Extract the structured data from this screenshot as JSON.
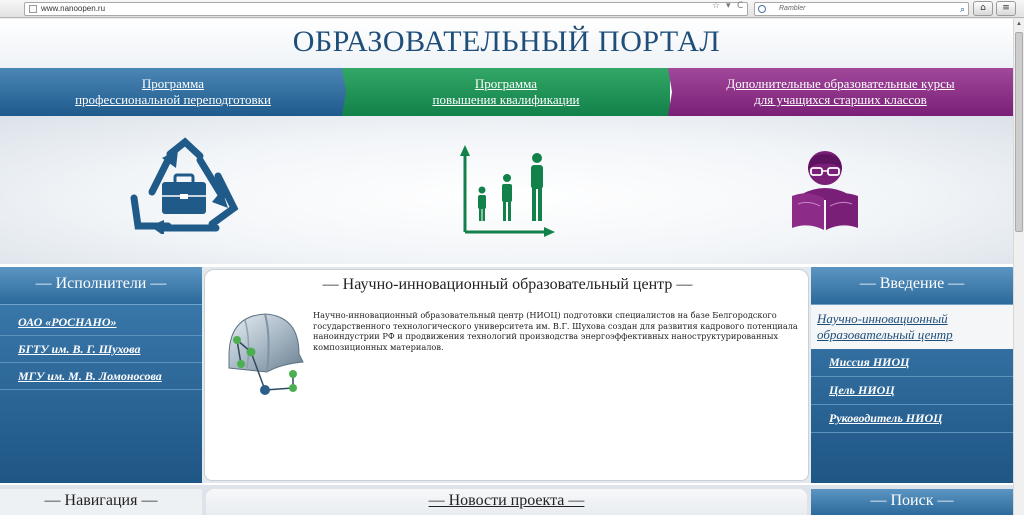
{
  "browser": {
    "url": "www.nanoopen.ru",
    "search_placeholder": "Rambler",
    "star": "☆",
    "dropdown": "▾",
    "reload": "C",
    "search_btn": "⌕",
    "home_btn": "⌂",
    "menu_btn": "≡"
  },
  "header": {
    "title": "ОБРАЗОВАТЕЛЬНЫЙ ПОРТАЛ"
  },
  "tabs": [
    {
      "line1": "Программа",
      "line2": "профессиональной переподготовки",
      "color": "#1e5a8c"
    },
    {
      "line1": "Программа",
      "line2": "повышения квалификации",
      "color": "#13814a"
    },
    {
      "line1": "Дополнительные образовательные курсы",
      "line2": "для учащихся старших классов",
      "color": "#7a1f77"
    }
  ],
  "left": {
    "heading": "— Исполнители —",
    "links": [
      "ОАО «РОСНАНО»",
      "БГТУ им. В. Г. Шухова",
      "МГУ им. М. В. Ломоносова"
    ]
  },
  "center": {
    "heading": "— Научно-инновационный образовательный центр —",
    "text": "Научно-инновационный образовательный центр (НИОЦ) подготовки специалистов на базе Белгородского государственного технологического университета им. В.Г. Шухова создан для развития кадрового потенциала наноиндустрии РФ и продвижения технологий производства энергоэффективных наноструктурированных композиционных материалов."
  },
  "right": {
    "heading": "— Введение —",
    "active_link": "Научно-инновационный образовательный центр",
    "links": [
      "Миссия НИОЦ",
      "Цель НИОЦ",
      "Руководитель НИОЦ"
    ]
  },
  "bottom": {
    "left": "— Навигация —",
    "center": "— Новости проекта —",
    "right": "— Поиск —"
  }
}
